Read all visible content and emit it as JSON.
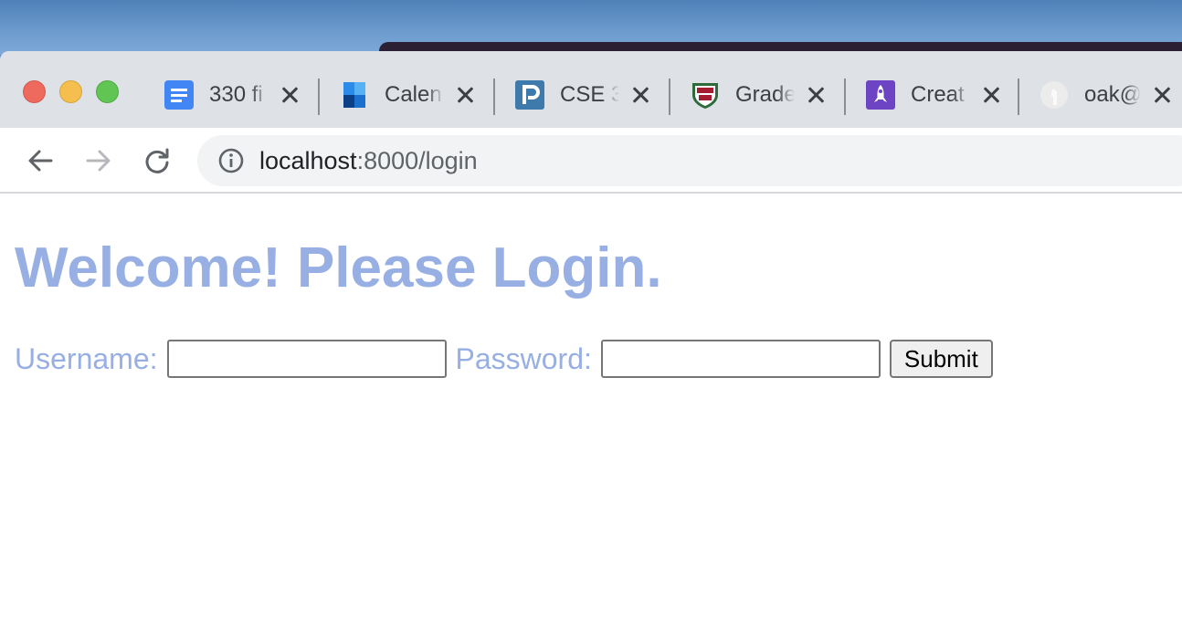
{
  "tabs": [
    {
      "title": "330 fi",
      "icon": "google-docs-icon"
    },
    {
      "title": "Calen",
      "icon": "outlook-calendar-icon"
    },
    {
      "title": "CSE 3",
      "icon": "piazza-icon"
    },
    {
      "title": "Grade",
      "icon": "university-shield-icon"
    },
    {
      "title": "Creat",
      "icon": "rocket-icon"
    },
    {
      "title": "oak@",
      "icon": "github-icon"
    }
  ],
  "address_bar": {
    "host": "localhost",
    "path": ":8000/login"
  },
  "page": {
    "heading": "Welcome! Please Login.",
    "username_label": "Username:",
    "username_value": "",
    "password_label": "Password:",
    "password_value": "",
    "submit_label": "Submit"
  },
  "colors": {
    "heading": "#97afe3",
    "tabstrip": "#dee1e6",
    "omnibox": "#f1f3f4"
  }
}
